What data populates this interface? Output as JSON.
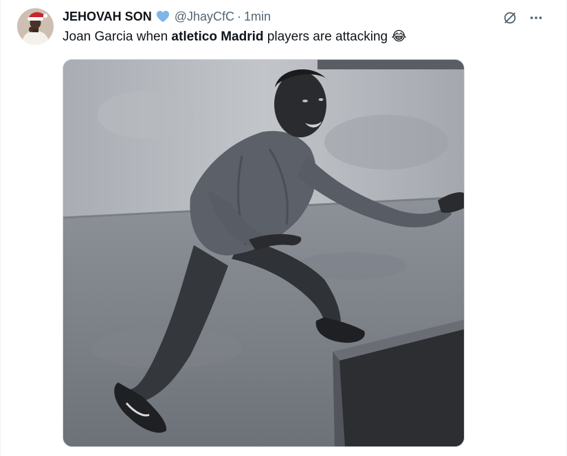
{
  "tweet": {
    "display_name": "JEHOVAH SON",
    "handle": "@JhayCfC",
    "separator": "·",
    "time": "1min",
    "text_part1": "Joan Garcia when ",
    "text_bold": "atletico Madrid",
    "text_part2": " players are attacking ",
    "emoji": "😂"
  },
  "icons": {
    "verified": "verified-badge-icon",
    "grok": "grok-icon",
    "more": "more-icon"
  },
  "colors": {
    "verified": "#7fb6e9",
    "text": "#0f1419",
    "secondary": "#536471"
  }
}
